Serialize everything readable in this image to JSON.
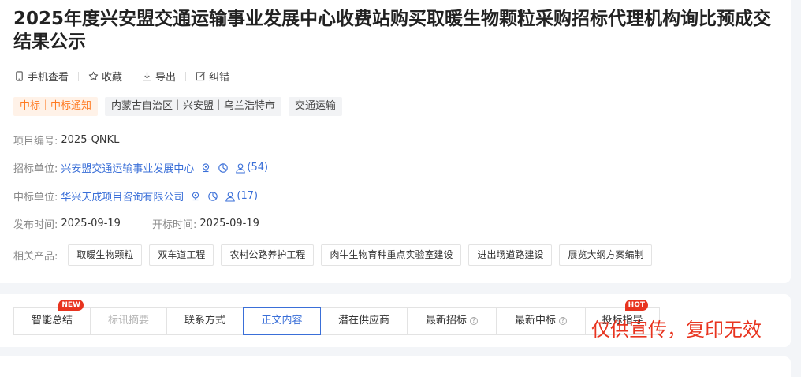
{
  "title": "2025年度兴安盟交通运输事业发展中心收费站购买取暖生物颗粒采购招标代理机构询比预成交结果公示",
  "actions": {
    "mobile": "手机查看",
    "favorite": "收藏",
    "export": "导出",
    "correct": "纠错"
  },
  "tags": {
    "type": "中标｜中标通知",
    "region": "内蒙古自治区｜兴安盟｜乌兰浩特市",
    "industry": "交通运输"
  },
  "info": {
    "project_no_label": "项目编号:",
    "project_no": "2025-QNKL",
    "tenderer_label": "招标单位:",
    "tenderer": "兴安盟交通运输事业发展中心",
    "tenderer_count": "(54)",
    "winner_label": "中标单位:",
    "winner": "华兴天成项目咨询有限公司",
    "winner_count": "(17)",
    "publish_label": "发布时间:",
    "publish_date": "2025-09-19",
    "open_label": "开标时间:",
    "open_date": "2025-09-19"
  },
  "products": {
    "label": "相关产品:",
    "items": [
      "取暖生物颗粒",
      "双车道工程",
      "农村公路养护工程",
      "肉牛生物育种重点实验室建设",
      "进出场道路建设",
      "展览大纲方案编制"
    ]
  },
  "tabs": [
    {
      "label": "智能总结",
      "badge": "NEW"
    },
    {
      "label": "标讯摘要"
    },
    {
      "label": "联系方式"
    },
    {
      "label": "正文内容"
    },
    {
      "label": "潜在供应商"
    },
    {
      "label": "最新招标"
    },
    {
      "label": "最新中标"
    },
    {
      "label": "投标指导",
      "badge": "HOT"
    }
  ],
  "watermark": "仅供宣传，复印无效",
  "colors": {
    "link": "#3a6fd8",
    "accent": "#ff7a21",
    "badge": "#e8341f"
  }
}
